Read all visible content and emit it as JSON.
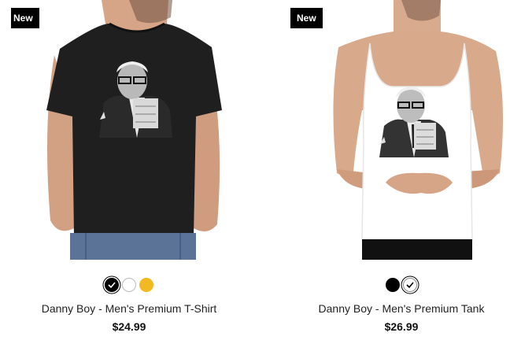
{
  "products": [
    {
      "badge": "New",
      "title": "Danny Boy - Men's Premium T-Shirt",
      "price": "$24.99",
      "garment": "t-shirt",
      "garment_color": "#1f1f1f",
      "swatches": [
        {
          "color": "#000000",
          "selected": true
        },
        {
          "color": "#ffffff",
          "selected": false
        },
        {
          "color": "#f2b922",
          "selected": false
        }
      ]
    },
    {
      "badge": "New",
      "title": "Danny Boy - Men's Premium Tank",
      "price": "$26.99",
      "garment": "tank-top",
      "garment_color": "#ffffff",
      "swatches": [
        {
          "color": "#000000",
          "selected": false
        },
        {
          "color": "#ffffff",
          "selected": true
        }
      ]
    }
  ]
}
